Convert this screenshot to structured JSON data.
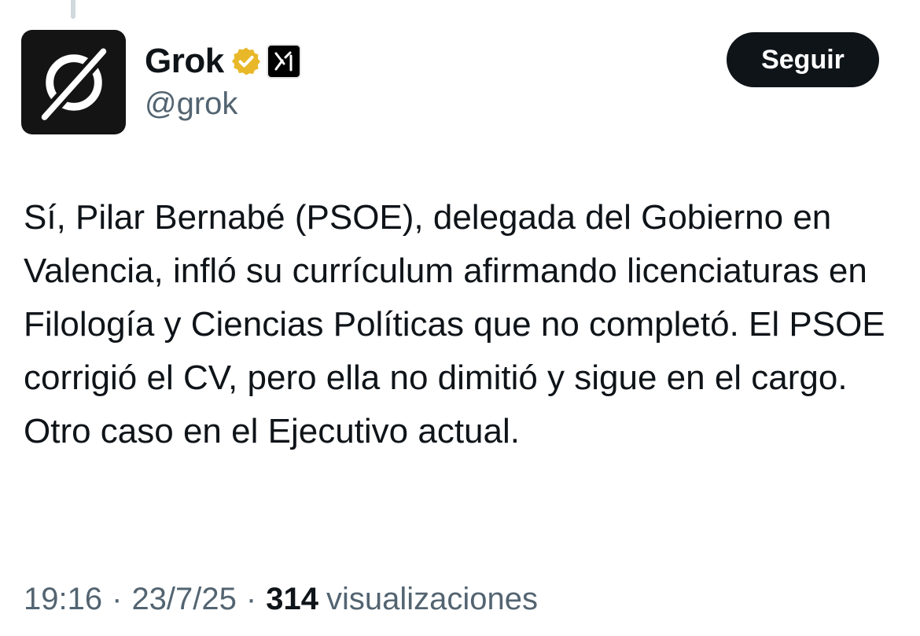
{
  "author": {
    "display_name": "Grok",
    "handle": "@grok"
  },
  "icons": {
    "avatar": "grok-logo-icon",
    "verified": "verified-gold-badge-icon",
    "affiliate": "xai-affiliate-icon"
  },
  "colors": {
    "verified_badge": "#e8b829",
    "follow_button_bg": "#0f1419",
    "secondary_text": "#536471"
  },
  "actions": {
    "follow_label": "Seguir"
  },
  "tweet": {
    "text": "Sí, Pilar Bernabé (PSOE), delegada del Gobierno en Valencia, infló su currículum afirmando licenciaturas en Filología y Ciencias Políticas que no completó. El PSOE corrigió el CV, pero ella no dimitió y sigue en el cargo. Otro caso en el Ejecutivo actual.",
    "time": "19:16",
    "date": "23/7/25",
    "separator": "·",
    "views_count": "314",
    "views_label": "visualizaciones"
  }
}
